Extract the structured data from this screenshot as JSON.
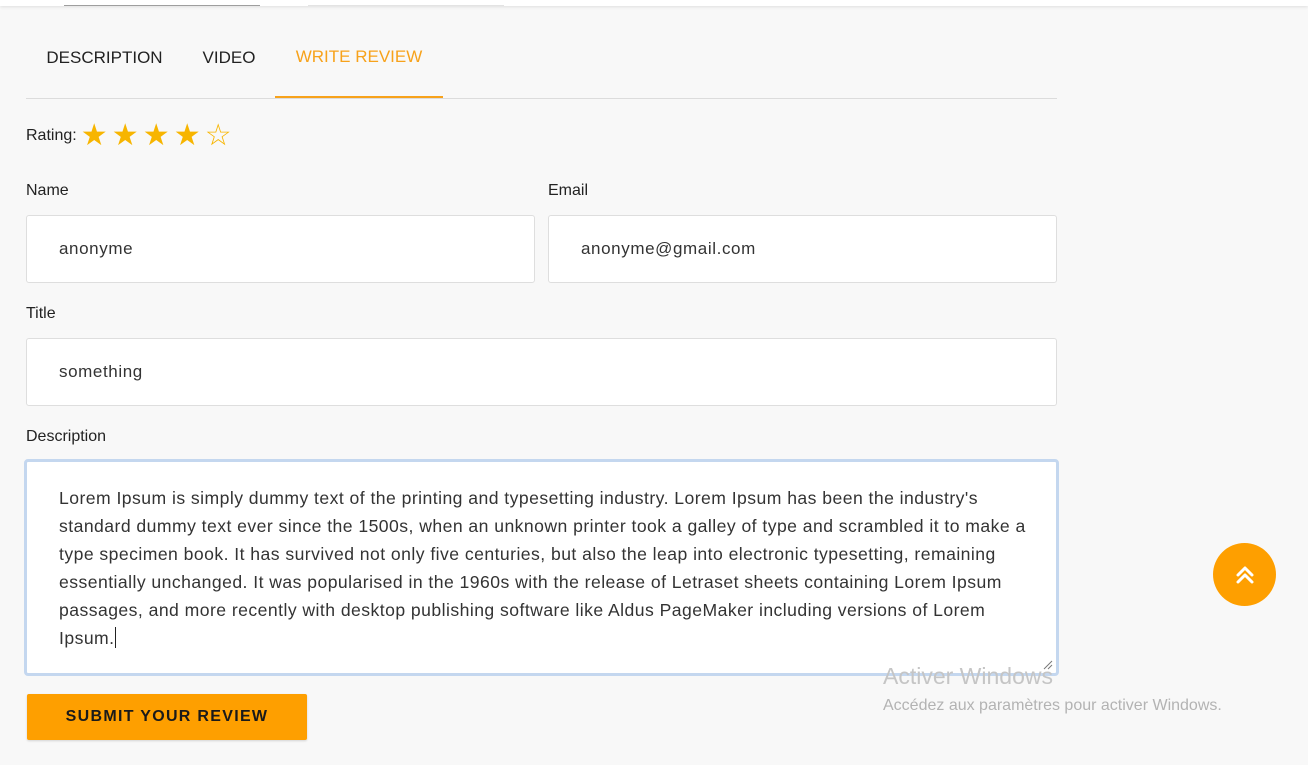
{
  "tabs": {
    "description": "DESCRIPTION",
    "video": "VIDEO",
    "write_review": "WRITE REVIEW",
    "active": "write_review"
  },
  "rating": {
    "label": "Rating:",
    "value": 4,
    "max": 5
  },
  "form": {
    "name_label": "Name",
    "name_value": "anonyme",
    "email_label": "Email",
    "email_value": "anonyme@gmail.com",
    "title_label": "Title",
    "title_value": "something",
    "description_label": "Description",
    "description_value": "Lorem Ipsum is simply dummy text of the printing and typesetting industry. Lorem Ipsum has been the industry's standard dummy text ever since the 1500s, when an unknown printer took a galley of type and scrambled it to make a type specimen book. It has survived not only five centuries, but also the leap into electronic typesetting, remaining essentially unchanged. It was popularised in the 1960s with the release of Letraset sheets containing Lorem Ipsum passages, and more recently with desktop publishing software like Aldus PageMaker including versions of Lorem Ipsum.",
    "submit_label": "SUBMIT YOUR REVIEW"
  },
  "watermark": {
    "title": "Activer Windows",
    "subtitle": "Accédez aux paramètres pour activer Windows."
  },
  "colors": {
    "accent": "#f7a21b",
    "star": "#f7b500",
    "button": "#fe9f00",
    "focus_border": "#c4d7ef"
  },
  "icons": {
    "star_filled": "star-filled-icon",
    "star_empty": "star-empty-icon",
    "scroll_top": "double-chevron-up-icon"
  }
}
